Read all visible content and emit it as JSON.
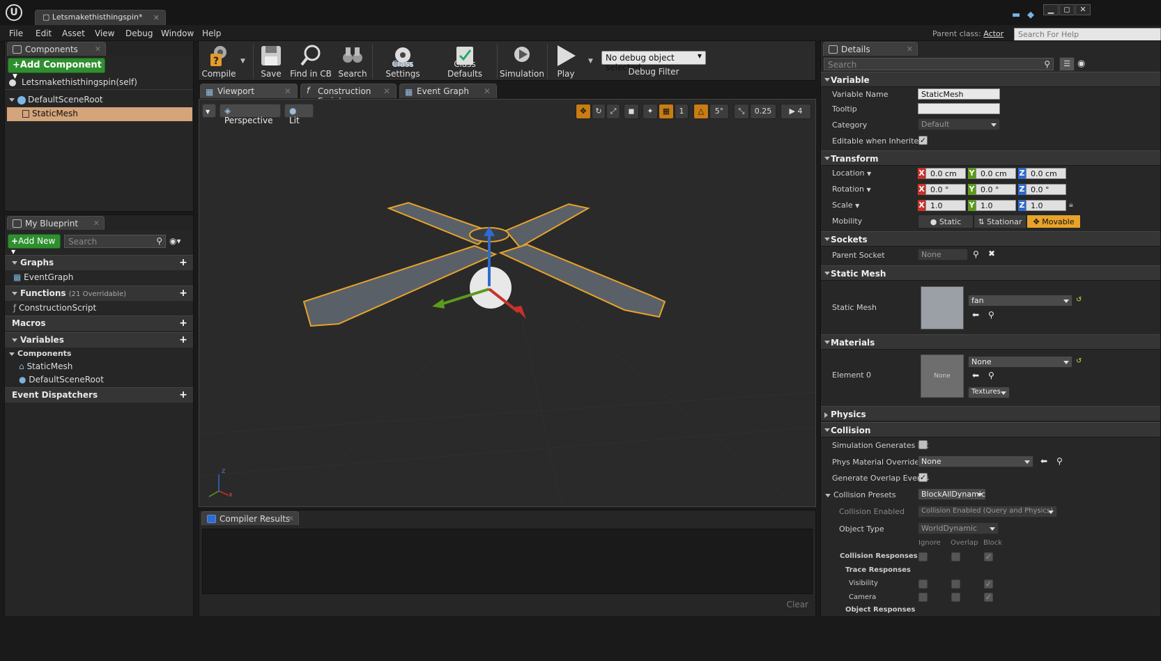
{
  "window": {
    "tab_title": "Letsmakethisthingspin*",
    "logo_text": "U",
    "controls": [
      "▁",
      "◻",
      "✕"
    ]
  },
  "menu": [
    "File",
    "Edit",
    "Asset",
    "View",
    "Debug",
    "Window",
    "Help"
  ],
  "parent_class": {
    "label": "Parent class:",
    "value": "Actor"
  },
  "help_search_placeholder": "Search For Help",
  "components_panel": {
    "tab": "Components",
    "add_button": "+Add Component",
    "self_row": "Letsmakethisthingspin(self)",
    "tree": [
      {
        "label": "DefaultSceneRoot"
      },
      {
        "label": "StaticMesh",
        "selected": true
      }
    ]
  },
  "my_blueprint": {
    "tab": "My Blueprint",
    "add_new": "Add New",
    "search_placeholder": "Search",
    "sections": {
      "graphs": "Graphs",
      "graphs_item": "EventGraph",
      "functions": "Functions",
      "functions_note": "(21 Overridable)",
      "functions_item": "ConstructionScript",
      "macros": "Macros",
      "variables": "Variables",
      "components_cat": "Components",
      "var_items": [
        "StaticMesh",
        "DefaultSceneRoot"
      ],
      "event_dispatchers": "Event Dispatchers"
    }
  },
  "toolbar": {
    "compile": "Compile",
    "save": "Save",
    "find_in_cb": "Find in CB",
    "search": "Search",
    "class_settings": "Class Settings",
    "class_defaults": "Class Defaults",
    "simulation": "Simulation",
    "play": "Play",
    "debug_object": "No debug object selected",
    "debug_filter": "Debug Filter"
  },
  "editor_tabs": [
    "Viewport",
    "Construction Script",
    "Event Graph"
  ],
  "viewport": {
    "perspective": "Perspective",
    "lit": "Lit",
    "rot_snap": "5°",
    "scale_snap": "0.25",
    "cam_speed": "4",
    "grid_snap": "1",
    "axis_x": "x",
    "axis_z": "z"
  },
  "compiler": {
    "tab": "Compiler Results",
    "clear": "Clear"
  },
  "details": {
    "tab": "Details",
    "search_placeholder": "Search",
    "variable": {
      "header": "Variable",
      "name_label": "Variable Name",
      "name_value": "StaticMesh",
      "tooltip_label": "Tooltip",
      "tooltip_value": "",
      "category_label": "Category",
      "category_value": "Default",
      "editable_label": "Editable when Inherited",
      "editable_checked": true
    },
    "transform": {
      "header": "Transform",
      "location_label": "Location",
      "location": [
        "0.0 cm",
        "0.0 cm",
        "0.0 cm"
      ],
      "rotation_label": "Rotation",
      "rotation": [
        "0.0 °",
        "0.0 °",
        "0.0 °"
      ],
      "scale_label": "Scale",
      "scale": [
        "1.0",
        "1.0",
        "1.0"
      ],
      "mobility_label": "Mobility",
      "mobility_options": [
        "Static",
        "Stationar",
        "Movable"
      ],
      "mobility_selected": "Movable",
      "axes": [
        "X",
        "Y",
        "Z"
      ],
      "axis_colors": [
        "#c8322a",
        "#5c9a1c",
        "#2d6bd0"
      ]
    },
    "sockets": {
      "header": "Sockets",
      "parent_label": "Parent Socket",
      "parent_value": "None"
    },
    "static_mesh": {
      "header": "Static Mesh",
      "label": "Static Mesh",
      "value": "fan"
    },
    "materials": {
      "header": "Materials",
      "label": "Element 0",
      "value": "None",
      "thumb_text": "None",
      "textures": "Textures"
    },
    "physics": {
      "header": "Physics"
    },
    "collision": {
      "header": "Collision",
      "sim_hit_label": "Simulation Generates Hit",
      "phys_mat_label": "Phys Material Override",
      "phys_mat_value": "None",
      "overlap_label": "Generate Overlap Events",
      "presets_label": "Collision Presets",
      "presets_value": "BlockAllDynamic",
      "enabled_label": "Collision Enabled",
      "enabled_value": "Collision Enabled (Query and Physics)",
      "object_type_label": "Object Type",
      "object_type_value": "WorldDynamic",
      "col_ignore": "Ignore",
      "col_overlap": "Overlap",
      "col_block": "Block",
      "responses_label": "Collision Responses",
      "trace_label": "Trace Responses",
      "visibility_label": "Visibility",
      "camera_label": "Camera",
      "object_responses_label": "Object Responses"
    }
  },
  "accent_colors": {
    "select_orange": "#e8a32a",
    "add_green": "#2f8f2f"
  }
}
